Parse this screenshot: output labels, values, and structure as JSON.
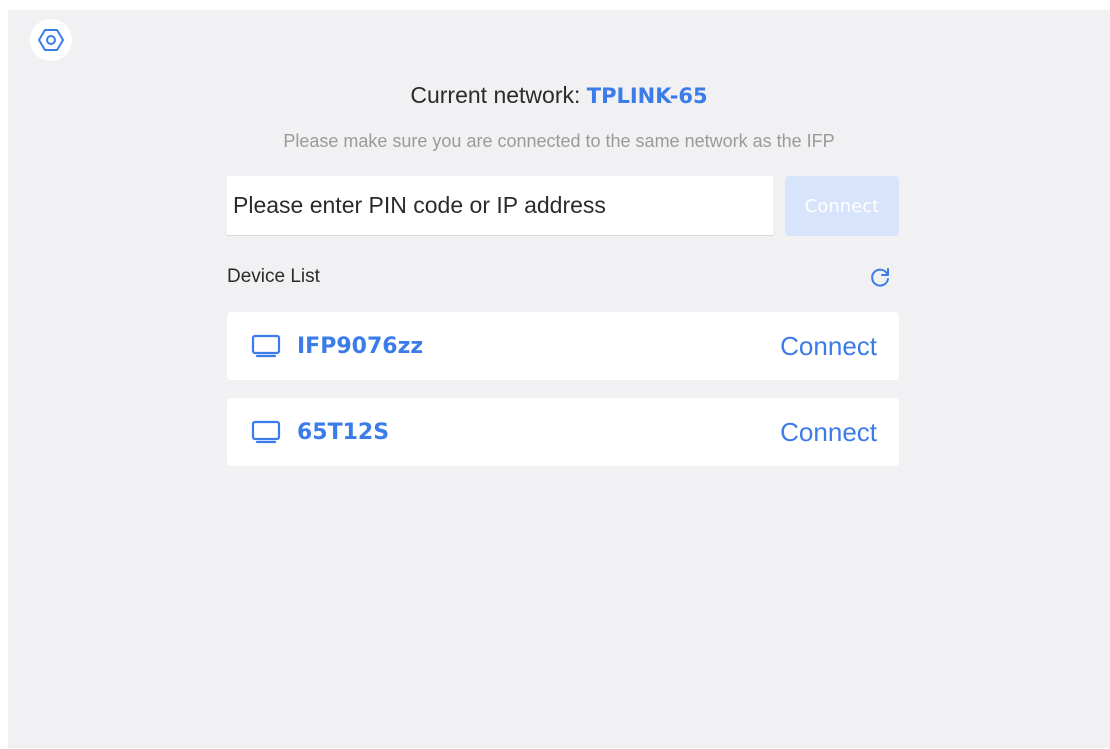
{
  "header": {
    "network_label": "Current network: ",
    "network_name": "TPLINK-65",
    "hint": "Please make sure you are connected to the same network as the IFP"
  },
  "pin_entry": {
    "placeholder": "Please enter PIN code or IP address",
    "value": "",
    "connect_label": "Connect",
    "connect_enabled": false
  },
  "device_list": {
    "title": "Device List",
    "devices": [
      {
        "name": "IFP9076zz",
        "icon": "monitor-icon",
        "action_label": "Connect"
      },
      {
        "name": "65T12S",
        "icon": "monitor-icon",
        "action_label": "Connect"
      }
    ]
  },
  "icons": {
    "settings": "settings-hexagon-icon",
    "refresh": "refresh-icon"
  },
  "colors": {
    "accent": "#3b7bea",
    "background": "#f1f1f3",
    "disabled_button": "#d8e4fb",
    "hint_text": "#9a9a9a"
  }
}
